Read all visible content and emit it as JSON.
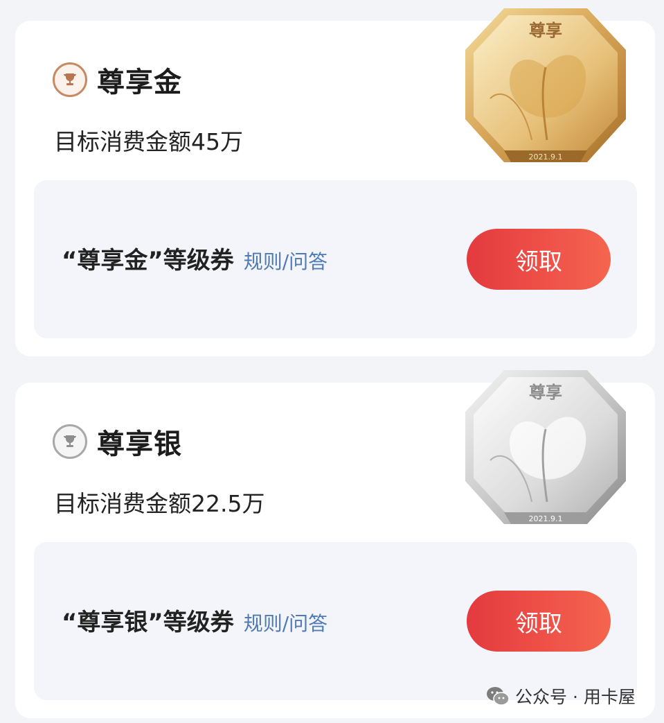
{
  "tiers": [
    {
      "name": "尊享金",
      "target": "目标消费金额45万",
      "coupon_name": "“尊享金”等级券",
      "rules_link": "规则/问答",
      "claim_label": "领取",
      "medal_text": "尊享",
      "medal_date": "2021.9.1",
      "medal_icon": "gold-magnolia-medal-icon",
      "accent": "#c58a62"
    },
    {
      "name": "尊享银",
      "target": "目标消费金额22.5万",
      "coupon_name": "“尊享银”等级券",
      "rules_link": "规则/问答",
      "claim_label": "领取",
      "medal_text": "尊享",
      "medal_date": "2021.9.1",
      "medal_icon": "silver-magnolia-medal-icon",
      "accent": "#a8a8a8"
    }
  ],
  "watermark": {
    "icon": "wechat-icon",
    "text": "公众号 · 用卡屋"
  },
  "colors": {
    "claim_button": "#e8423f",
    "link": "#4f7ab3",
    "background": "#f2f4f8"
  }
}
